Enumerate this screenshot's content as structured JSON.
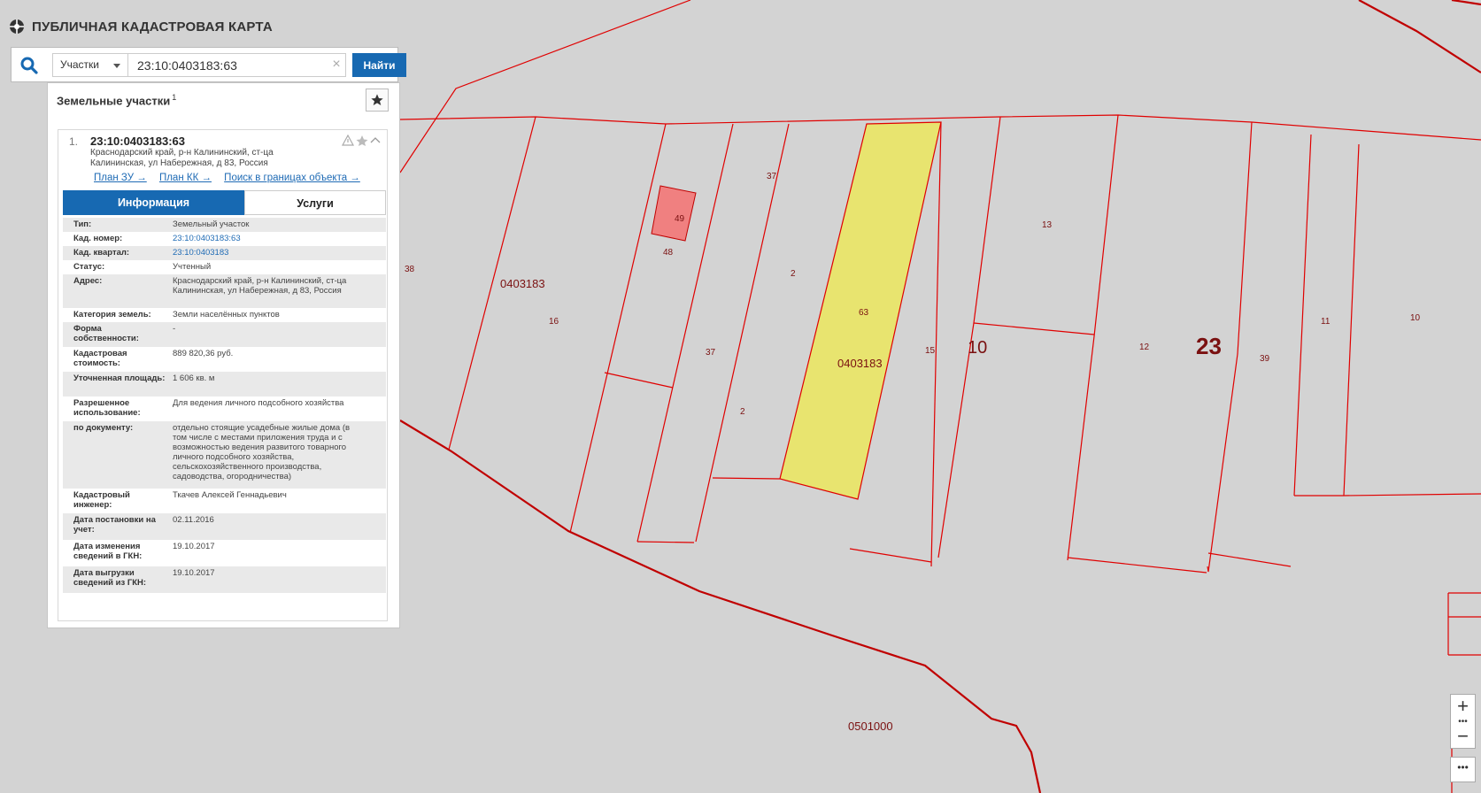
{
  "app": {
    "title": "ПУБЛИЧНАЯ КАДАСТРОВАЯ КАРТА"
  },
  "search": {
    "type_label": "Участки",
    "query": "23:10:0403183:63",
    "find_label": "Найти"
  },
  "panel": {
    "title": "Земельные участки",
    "count": "1",
    "result": {
      "index": "1.",
      "cad_number": "23:10:0403183:63",
      "address": "Краснодарский край, р-н Калининский, ст-ца Калининская, ул Набережная, д 83, Россия",
      "links": [
        "План ЗУ →",
        "План КК →",
        "Поиск в границах объекта →"
      ],
      "tabs": [
        "Информация",
        "Услуги"
      ],
      "rows": [
        {
          "k": "Тип:",
          "v": "Земельный участок"
        },
        {
          "k": "Кад. номер:",
          "v": "23:10:0403183:63"
        },
        {
          "k": "Кад. квартал:",
          "v": "23:10:0403183"
        },
        {
          "k": "Статус:",
          "v": "Учтенный"
        },
        {
          "k": "Адрес:",
          "v": "Краснодарский край, р-н Калининский, ст-ца Калининская, ул Набережная, д 83, Россия"
        },
        {
          "k": "Категория земель:",
          "v": "Земли населённых пунктов"
        },
        {
          "k": "Форма собственности:",
          "v": "-"
        },
        {
          "k": "Кадастровая стоимость:",
          "v": "889 820,36 руб."
        },
        {
          "k": "Уточненная площадь:",
          "v": "1 606 кв. м"
        },
        {
          "k": "Разрешенное использование:",
          "v": "Для ведения личного подсобного хозяйства"
        },
        {
          "k": "по документу:",
          "v": "отдельно стоящие усадебные жилые дома (в том числе с местами приложения труда и с возможностью ведения развитого товарного личного подсобного хозяйства, сельскохозяйственного производства, садоводства, огородничества)"
        },
        {
          "k": "Кадастровый инженер:",
          "v": "Ткачев Алексей Геннадьевич"
        },
        {
          "k": "Дата постановки на учет:",
          "v": "02.11.2016"
        },
        {
          "k": "Дата изменения сведений в ГКН:",
          "v": "19.10.2017"
        },
        {
          "k": "Дата выгрузки сведений из ГКН:",
          "v": "19.10.2017"
        }
      ]
    }
  },
  "map": {
    "labels": {
      "quarter_main": "0403183",
      "quarter_highlight": "0403183",
      "quarter_south": "0501000",
      "district": "10",
      "region": "23",
      "parcels": [
        "38",
        "16",
        "48",
        "49",
        "37",
        "37",
        "2",
        "2",
        "63",
        "15",
        "13",
        "12",
        "39",
        "11",
        "10"
      ]
    },
    "colors": {
      "background": "#d3d3d3",
      "boundary": "#e00000",
      "highlight_fill": "#e8e46f",
      "small_parcel_fill": "#f08080",
      "label": "#7a1010",
      "accent": "#1769b2"
    }
  },
  "controls": {
    "zoom_in": "+",
    "zoom_out": "−",
    "more": "•••"
  }
}
